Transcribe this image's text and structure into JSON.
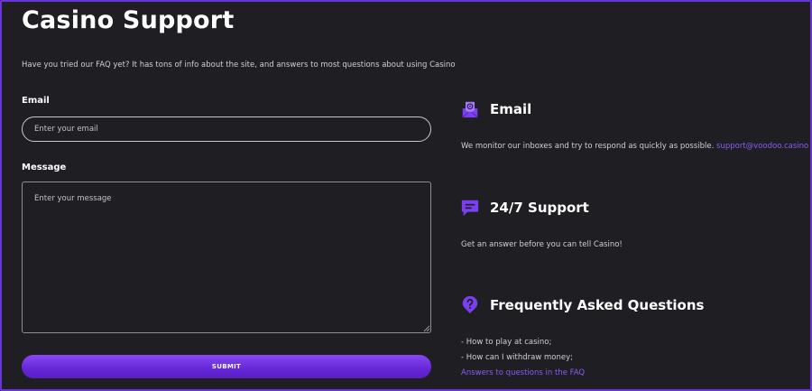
{
  "page": {
    "title": "Casino Support",
    "intro": "Have you tried our FAQ yet? It has tons of info about the site, and answers to most questions about using Casino"
  },
  "form": {
    "email_label": "Email",
    "email_placeholder": "Enter your email",
    "message_label": "Message",
    "message_placeholder": "Enter your message",
    "submit_label": "SUBMIT"
  },
  "contact_email": {
    "icon": "envelope-at-icon",
    "title": "Email",
    "text": "We monitor our inboxes and try to respond as quickly as possible.",
    "link": "support@voodoo.casino"
  },
  "support": {
    "icon": "chat-bubble-icon",
    "title": "24/7 Support",
    "text": "Get an answer before you can tell Casino!"
  },
  "faq": {
    "icon": "question-pin-icon",
    "title": "Frequently Asked Questions",
    "items": [
      "- How to play at casino;",
      "- How can I withdraw money;"
    ],
    "link": "Answers to questions in the FAQ"
  },
  "colors": {
    "background": "#1f1e23",
    "accent": "#7b3ff0",
    "link": "#8a5cf5",
    "frame_border": "#6a35d8"
  }
}
